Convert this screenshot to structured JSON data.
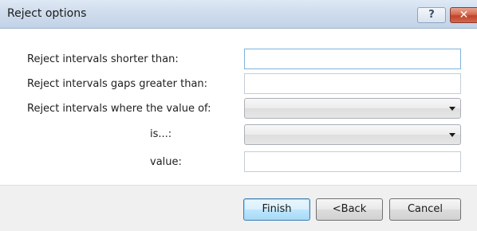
{
  "window": {
    "title": "Reject options",
    "help_glyph": "?",
    "close_glyph": "✕"
  },
  "form": {
    "shorter_than_label": "Reject intervals shorter than:",
    "shorter_than_value": "",
    "gaps_label": "Reject intervals gaps greater than:",
    "gaps_value": "",
    "value_of_label": "Reject intervals where the value of:",
    "value_of_selected": "",
    "is_label": "is...:",
    "is_selected": "",
    "value_label": "value:",
    "value_value": ""
  },
  "buttons": {
    "finish": "Finish",
    "back": "<Back",
    "cancel": "Cancel"
  }
}
